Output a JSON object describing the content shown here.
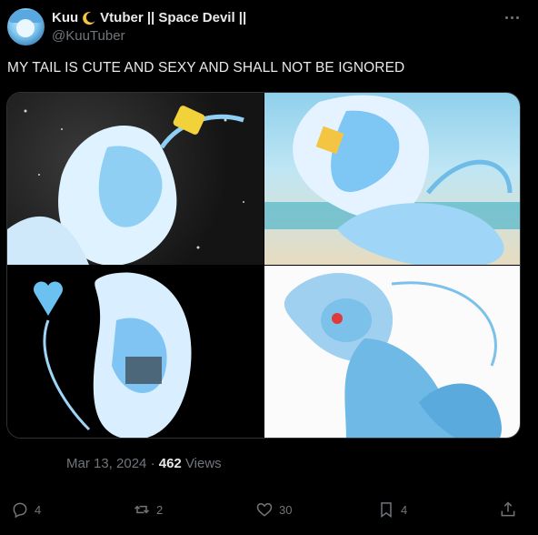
{
  "author": {
    "display_name_part1": "Kuu",
    "display_name_part2": "Vtuber || Space Devil ||",
    "handle": "@KuuTuber"
  },
  "tweet": {
    "text": "MY TAIL IS CUTE AND SEXY AND SHALL NOT BE IGNORED"
  },
  "meta": {
    "date": "Mar 13, 2024",
    "separator": "·",
    "views_count": "462",
    "views_label": "Views"
  },
  "actions": {
    "replies": "4",
    "reposts": "2",
    "likes": "30",
    "bookmarks": "4"
  },
  "colors": {
    "background": "#000000",
    "text_primary": "#e7e9ea",
    "text_secondary": "#71767b",
    "border": "#2f3336"
  },
  "icons": [
    "moon-icon",
    "more-icon",
    "reply-icon",
    "repost-icon",
    "like-icon",
    "bookmark-icon",
    "share-icon"
  ]
}
